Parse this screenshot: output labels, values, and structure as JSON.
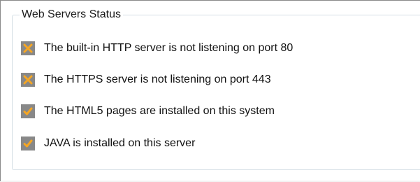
{
  "group": {
    "title": "Web Servers Status"
  },
  "items": [
    {
      "status": "fail",
      "icon": "x-mark-icon",
      "text": "The built-in HTTP server is not listening on port 80"
    },
    {
      "status": "fail",
      "icon": "x-mark-icon",
      "text": "The HTTPS server is not listening on port 443"
    },
    {
      "status": "ok",
      "icon": "checkmark-icon",
      "text": "The HTML5 pages are installed on this system"
    },
    {
      "status": "ok",
      "icon": "checkmark-icon",
      "text": "JAVA is installed on this server"
    }
  ],
  "colors": {
    "badge_bg": "#888888",
    "icon_accent": "#f5a623",
    "group_border": "#d5dfe5"
  }
}
